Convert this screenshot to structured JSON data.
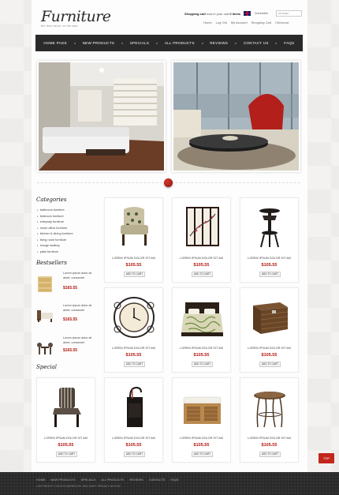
{
  "header": {
    "logo": "Furniture",
    "tagline": "the best store on the web",
    "cart_label": "Shopping cart",
    "cart_text": "now in your cart",
    "cart_count": "0 items",
    "currencies_label": "Currencies",
    "currency_value": "US Dollar",
    "toplinks": [
      "Home",
      "Log Out",
      "My Account",
      "Shopping Cart",
      "Checkout"
    ]
  },
  "nav": [
    "HOME PAGE",
    "NEW PRODUCTS",
    "SPECIALS",
    "ALL PRODUCTS",
    "REVIEWS",
    "CONTACT US",
    "FAQS"
  ],
  "sidebar": {
    "categories_title": "Categories",
    "categories": [
      "bathroom furniture",
      "bedroom furniture",
      "entryway furniture",
      "home office furniture",
      "kitchen & dining furniture",
      "living room furniture",
      "lounge seating",
      "patio furniture"
    ],
    "bestsellers_title": "Bestsellers",
    "bestsellers": [
      {
        "text": "Lorem ipsum dolor sit amet, consectet",
        "price": "$165.55"
      },
      {
        "text": "Lorem ipsum dolor sit amet, consectet",
        "price": "$165.55"
      },
      {
        "text": "Lorem ipsum dolor sit amet, consectet",
        "price": "$165.55"
      }
    ],
    "special_title": "Special"
  },
  "products": [
    {
      "name": "LOREM IPSUM DOLOR SIT AM",
      "price": "$105.55",
      "button": "ADD TO CART",
      "icon": "armchair-icon"
    },
    {
      "name": "LOREM IPSUM DOLOR SIT AM",
      "price": "$105.55",
      "button": "ADD TO CART",
      "icon": "folding-screen-icon"
    },
    {
      "name": "LOREM IPSUM DOLOR SIT AM",
      "price": "$105.55",
      "button": "ADD TO CART",
      "icon": "side-table-icon"
    },
    {
      "name": "LOREM IPSUM DOLOR SIT AM",
      "price": "$105.55",
      "button": "ADD TO CART",
      "icon": "wall-clock-icon"
    },
    {
      "name": "LOREM IPSUM DOLOR SIT AM",
      "price": "$105.55",
      "button": "ADD TO CART",
      "icon": "bed-icon"
    },
    {
      "name": "LOREM IPSUM DOLOR SIT AM",
      "price": "$105.55",
      "button": "ADD TO CART",
      "icon": "wicker-trunk-icon"
    },
    {
      "name": "LOREM IPSUM DOLOR SIT AM",
      "price": "$105.55",
      "button": "ADD TO CART",
      "icon": "striped-chair-icon"
    },
    {
      "name": "LOREM IPSUM DOLOR SIT AM",
      "price": "$105.55",
      "button": "ADD TO CART",
      "icon": "umbrella-stand-icon"
    },
    {
      "name": "LOREM IPSUM DOLOR SIT AM",
      "price": "$105.55",
      "button": "ADD TO CART",
      "icon": "bench-icon"
    },
    {
      "name": "LOREM IPSUM DOLOR SIT AM",
      "price": "$105.55",
      "button": "ADD TO CART",
      "icon": "bistro-table-icon"
    }
  ],
  "footer": {
    "links": [
      "HOME",
      "NEW PRODUCTS",
      "SPECIALS",
      "ALL PRODUCTS",
      "REVIEWS",
      "CONTACTS",
      "FAQS"
    ],
    "copyright": "COPYRIGHT © 2013 POWERED BY ZEN CART. PRIVACY NOTICE",
    "top_button": "TOP"
  },
  "colors": {
    "accent": "#b3170f",
    "nav_bg": "#2a2a2a",
    "top_button": "#c2271c"
  }
}
